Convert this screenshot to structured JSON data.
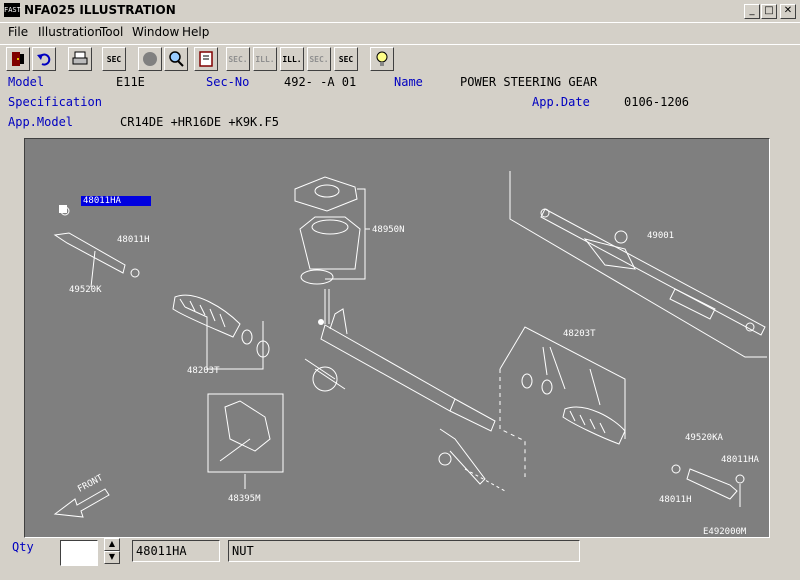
{
  "window": {
    "title": "NFA025 ILLUSTRATION",
    "icon_text": "FAST"
  },
  "window_controls": {
    "minimize": "_",
    "maximize": "□",
    "close": "✕"
  },
  "menu": [
    "File",
    "Illustration",
    "Tool",
    "Window",
    "Help"
  ],
  "toolbar": {
    "buttons": [
      {
        "name": "exit-tool-button",
        "text": "",
        "icon": "exit-door-icon"
      },
      {
        "name": "undo-tool-button",
        "text": "",
        "icon": "undo-arrow-icon"
      },
      {
        "name": "print-tool-button",
        "text": "",
        "icon": "printer-icon"
      },
      {
        "name": "sec-index-button",
        "text": "SEC",
        "icon": "section-index-icon"
      },
      {
        "name": "circle-tool-button",
        "text": "",
        "icon": "circle-icon"
      },
      {
        "name": "zoom-tool-button",
        "text": "",
        "icon": "magnifier-icon"
      },
      {
        "name": "book-tool-button",
        "text": "",
        "icon": "book-icon"
      },
      {
        "name": "prev-sec-button",
        "text": "SEC.",
        "icon": "prev-section-icon"
      },
      {
        "name": "prev-ill-button",
        "text": "ILL.",
        "icon": "prev-illustration-icon"
      },
      {
        "name": "next-ill-button",
        "text": "ILL.",
        "icon": "next-illustration-icon"
      },
      {
        "name": "next-sec-button",
        "text": "SEC.",
        "icon": "next-section-icon"
      },
      {
        "name": "sec-query-button",
        "text": "SEC",
        "icon": "section-query-icon"
      },
      {
        "name": "help-tool-button",
        "text": "",
        "icon": "help-bulb-icon"
      }
    ]
  },
  "info": {
    "model_label": "Model",
    "model_value": "E11E",
    "secno_label": "Sec-No",
    "secno_value": "492-  -A 01",
    "name_label": "Name",
    "name_value": "POWER STEERING GEAR",
    "spec_label": "Specification",
    "appdate_label": "App.Date",
    "appdate_value": "0106-1206",
    "appmodel_label": "App.Model",
    "appmodel_value": "CR14DE +HR16DE +K9K.F5"
  },
  "illustration": {
    "parts": [
      "48011HA",
      "48011H",
      "49520K",
      "48950N",
      "48203T",
      "48395M",
      "49001",
      "48203T",
      "49520KA",
      "48011HA",
      "48011H"
    ],
    "selected_part": "48011HA",
    "direction_label": "FRONT",
    "figure_id": "E492000M"
  },
  "bottom": {
    "qty_label": "Qty",
    "qty_value": "",
    "part_number": "48011HA",
    "part_name": "NUT"
  }
}
